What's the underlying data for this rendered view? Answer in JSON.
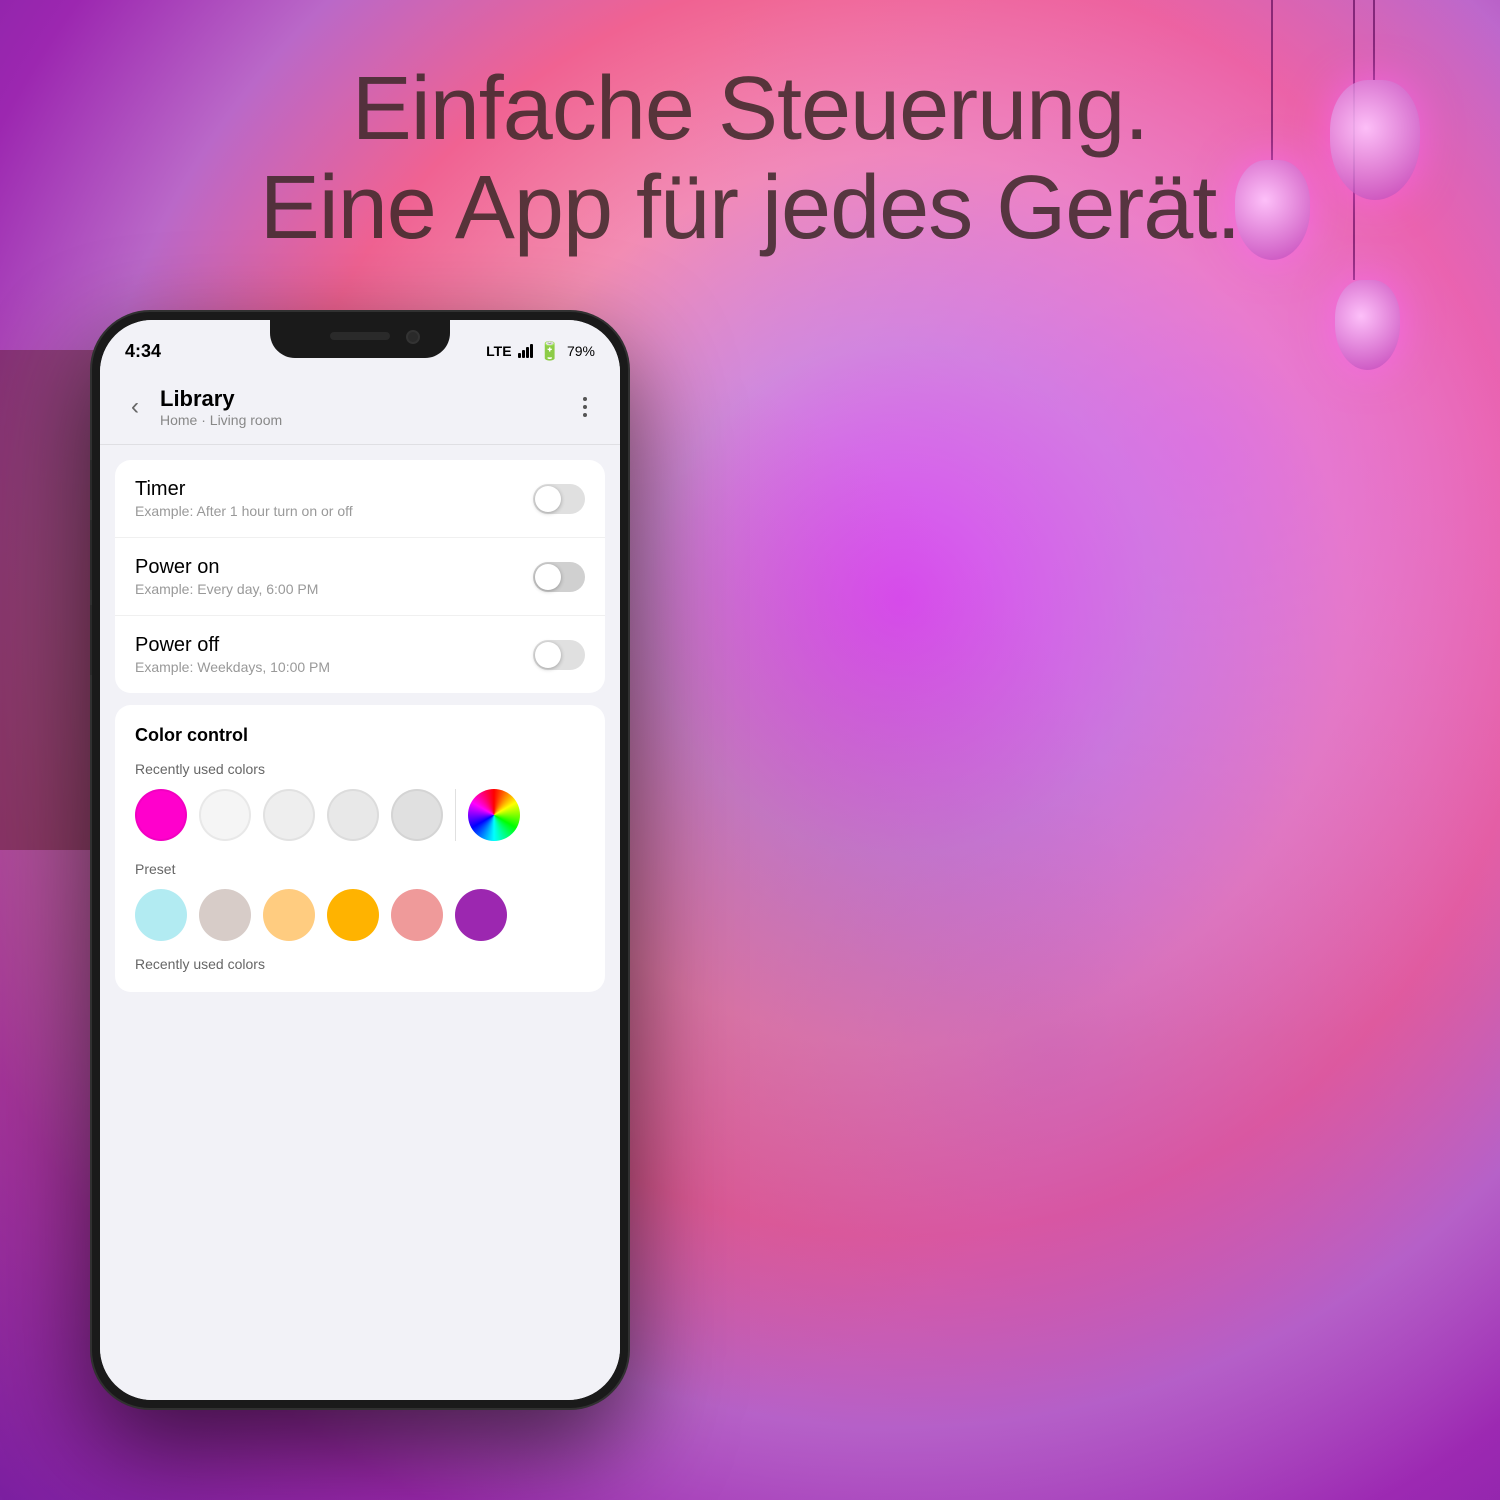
{
  "background": {
    "gradient_description": "pink-purple room with smart lighting"
  },
  "headline": {
    "line1": "Einfache Steuerung.",
    "line2": "Eine App für jedes Gerät."
  },
  "phone": {
    "status_bar": {
      "time": "4:34",
      "lte": "LTE",
      "battery_percent": "79%"
    },
    "header": {
      "back_label": "‹",
      "title": "Library",
      "subtitle": "Home · Living room",
      "menu_label": "⋮"
    },
    "timer_row": {
      "label": "Timer",
      "description": "Example: After 1 hour turn on or off"
    },
    "power_on_row": {
      "label": "Power on",
      "description": "Example: Every day, 6:00 PM"
    },
    "power_off_row": {
      "label": "Power off",
      "description": "Example: Weekdays, 10:00 PM"
    },
    "color_control": {
      "section_title": "Color control",
      "recently_label": "Recently used colors",
      "recent_colors": [
        "#ff00cc",
        "#f5f5f5",
        "#eeeeee",
        "#e8e8e8",
        "#e0e0e0"
      ],
      "preset_label": "Preset",
      "preset_colors": [
        "#b2ebf2",
        "#d7ccc8",
        "#ffcc80",
        "#ffb300",
        "#ef9a9a",
        "#9c27b0"
      ],
      "recently_used_label": "Recently used colors"
    }
  }
}
